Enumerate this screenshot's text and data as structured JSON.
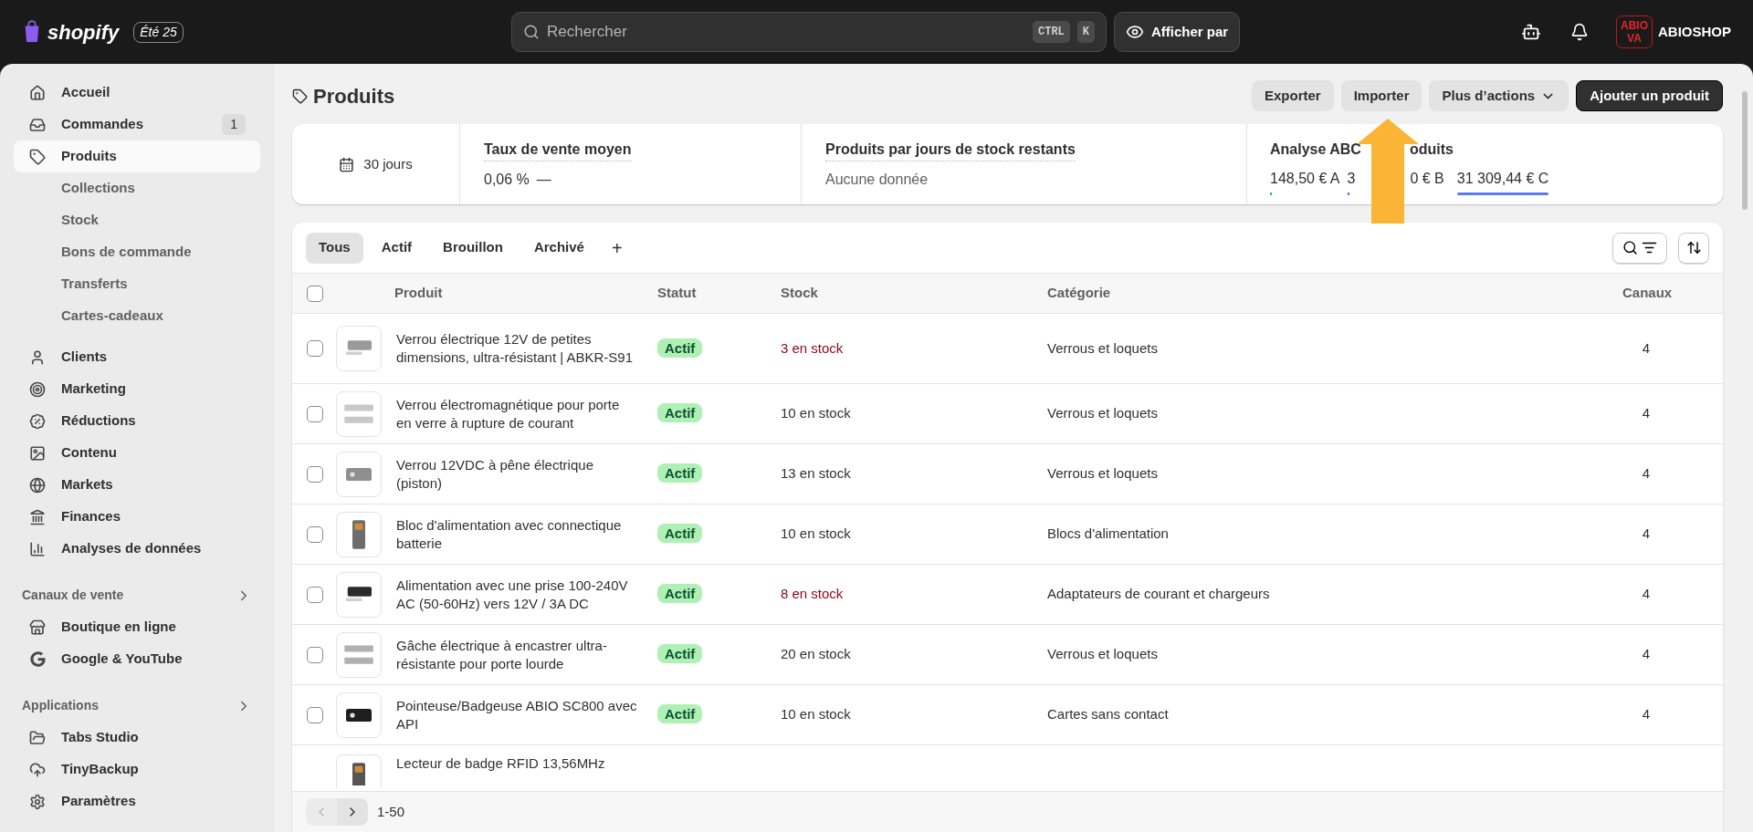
{
  "topbar": {
    "logo": "shopify",
    "edition": "Été 25",
    "search": {
      "placeholder": "Rechercher",
      "shortcut": [
        "CTRL",
        "K"
      ]
    },
    "view_button": "Afficher par",
    "store": {
      "logo_lines": [
        "ABIO",
        "VA"
      ],
      "name": "ABIOSHOP"
    }
  },
  "sidebar": {
    "items": [
      {
        "label": "Accueil",
        "selected": false
      },
      {
        "label": "Commandes",
        "selected": false,
        "badge": "1"
      },
      {
        "label": "Produits",
        "selected": true,
        "children": [
          {
            "label": "Collections"
          },
          {
            "label": "Stock"
          },
          {
            "label": "Bons de commande"
          },
          {
            "label": "Transferts"
          },
          {
            "label": "Cartes-cadeaux"
          }
        ]
      },
      {
        "label": "Clients",
        "selected": false
      },
      {
        "label": "Marketing",
        "selected": false
      },
      {
        "label": "Réductions",
        "selected": false
      },
      {
        "label": "Contenu",
        "selected": false
      },
      {
        "label": "Markets",
        "selected": false
      },
      {
        "label": "Finances",
        "selected": false
      },
      {
        "label": "Analyses de données",
        "selected": false
      }
    ],
    "sections": [
      {
        "title": "Canaux de vente",
        "items": [
          {
            "label": "Boutique en ligne",
            "selected": false
          },
          {
            "label": "Google & YouTube",
            "selected": false
          }
        ]
      },
      {
        "title": "Applications",
        "items": [
          {
            "label": "Tabs Studio",
            "selected": false
          },
          {
            "label": "TinyBackup",
            "selected": false
          }
        ]
      }
    ],
    "settings": {
      "label": "Paramètres",
      "selected": false
    }
  },
  "page": {
    "title": "Produits",
    "actions": [
      {
        "label": "Exporter",
        "kind": "secondary"
      },
      {
        "label": "Importer",
        "kind": "secondary"
      },
      {
        "label": "Plus d’actions",
        "kind": "menu"
      },
      {
        "label": "Ajouter un produit",
        "kind": "primary"
      }
    ]
  },
  "stats": {
    "period": "30 jours",
    "metrics": [
      {
        "title": "Taux de vente moyen",
        "value": "0,06 %",
        "trend": "—"
      },
      {
        "title": "Produits par jours de stock restants",
        "empty": "Aucune donnée"
      }
    ],
    "abc": {
      "title_parts": [
        "Analyse ABC",
        "oduits"
      ],
      "values": [
        {
          "text": "148,50 € A",
          "kind": "tick",
          "color": "#3b9be8"
        },
        {
          "parts": [
            "3",
            "0 € B"
          ],
          "kind": "tick",
          "color": "#7a5af0"
        },
        {
          "text": "31 309,44 € C",
          "kind": "full",
          "color": "#5b7cf0"
        }
      ]
    }
  },
  "table": {
    "tabs": [
      {
        "label": "Tous",
        "selected": true
      },
      {
        "label": "Actif",
        "selected": false
      },
      {
        "label": "Brouillon",
        "selected": false
      },
      {
        "label": "Archivé",
        "selected": false
      }
    ],
    "add_tab": "+",
    "columns": [
      "Produit",
      "Statut",
      "Stock",
      "Catégorie",
      "Canaux"
    ],
    "all_checked": false,
    "rows": [
      {
        "kind": "full",
        "product": "Verrou électrique 12V de petites dimensions, ultra-résistant | ABKR-S91",
        "status": "Actif",
        "stock": "3 en stock",
        "low": true,
        "category": "Verrous et loquets",
        "channels": "4",
        "checked": false
      },
      {
        "kind": "full",
        "product": "Verrou électromagnétique pour porte en verre à rupture de courant",
        "status": "Actif",
        "stock": "10 en stock",
        "low": false,
        "category": "Verrous et loquets",
        "channels": "4",
        "checked": false
      },
      {
        "kind": "full",
        "product": "Verrou 12VDC à pêne électrique (piston)",
        "status": "Actif",
        "stock": "13 en stock",
        "low": false,
        "category": "Verrous et loquets",
        "channels": "4",
        "checked": false
      },
      {
        "kind": "full",
        "product": "Bloc d'alimentation avec connectique batterie",
        "status": "Actif",
        "stock": "10 en stock",
        "low": false,
        "category": "Blocs d'alimentation",
        "channels": "4",
        "checked": false
      },
      {
        "kind": "full",
        "product": "Alimentation avec une prise 100-240V AC (50-60Hz) vers 12V / 3A DC",
        "status": "Actif",
        "stock": "8 en stock",
        "low": true,
        "category": "Adaptateurs de courant et chargeurs",
        "channels": "4",
        "checked": false
      },
      {
        "kind": "full",
        "product": "Gâche électrique à encastrer ultra-résistante pour porte lourde",
        "status": "Actif",
        "stock": "20 en stock",
        "low": false,
        "category": "Verrous et loquets",
        "channels": "4",
        "checked": false
      },
      {
        "kind": "full",
        "product": "Pointeuse/Badgeuse ABIO SC800 avec API",
        "status": "Actif",
        "stock": "10 en stock",
        "low": false,
        "category": "Cartes sans contact",
        "channels": "4",
        "checked": false
      },
      {
        "kind": "partial",
        "product": "Lecteur de badge RFID 13,56MHz"
      }
    ],
    "pagination": {
      "range": "1-50",
      "prev_disabled": true,
      "next_disabled": false
    }
  }
}
